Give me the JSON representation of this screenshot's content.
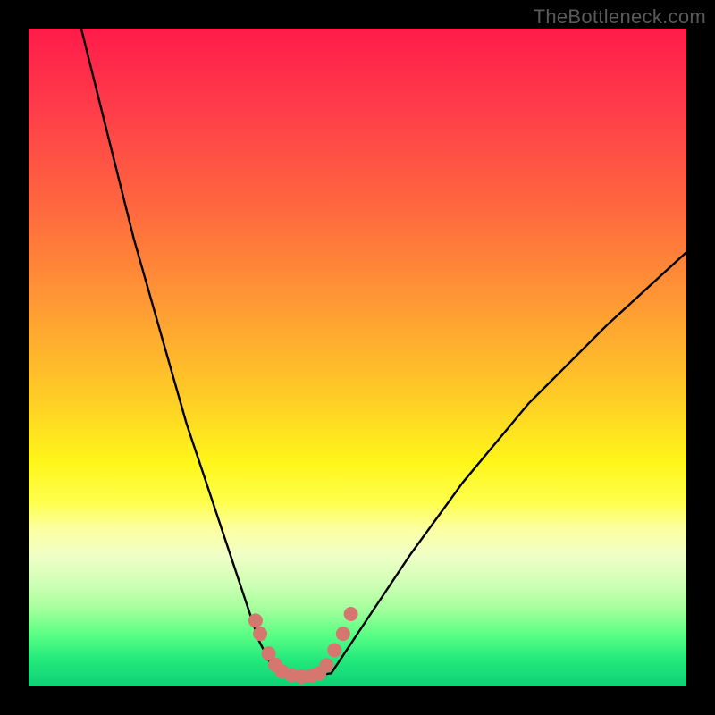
{
  "watermark": "TheBottleneck.com",
  "colors": {
    "curve": "#000000",
    "marker_fill": "#d6776f",
    "marker_stroke": "#b85b55",
    "frame": "#000000"
  },
  "chart_data": {
    "type": "line",
    "title": "",
    "xlabel": "",
    "ylabel": "",
    "xlim": [
      0,
      100
    ],
    "ylim": [
      0,
      100
    ],
    "series": [
      {
        "name": "left_curve",
        "x": [
          8,
          12,
          16,
          20,
          24,
          28,
          30,
          32,
          34,
          35,
          36,
          37,
          38
        ],
        "y": [
          100,
          84,
          68,
          54,
          40,
          28,
          22,
          16,
          10,
          7,
          5,
          3,
          2
        ]
      },
      {
        "name": "valley_floor",
        "x": [
          38,
          40,
          42,
          44,
          46
        ],
        "y": [
          2,
          1.5,
          1.5,
          1.7,
          2
        ]
      },
      {
        "name": "right_curve",
        "x": [
          46,
          48,
          52,
          58,
          66,
          76,
          88,
          100
        ],
        "y": [
          2,
          5,
          11,
          20,
          31,
          43,
          55,
          66
        ]
      }
    ],
    "markers": {
      "name": "valley_points",
      "x": [
        34.5,
        35.2,
        36.5,
        37.5,
        38.5,
        40,
        41.5,
        43,
        44.2,
        45.3,
        46.5,
        47.8,
        49
      ],
      "y": [
        10,
        8,
        5,
        3.3,
        2.3,
        1.7,
        1.5,
        1.6,
        2,
        3.2,
        5.5,
        8,
        11
      ]
    },
    "gradient_description": "vertical gradient red(top) → orange → yellow → pale → green(bottom)"
  }
}
